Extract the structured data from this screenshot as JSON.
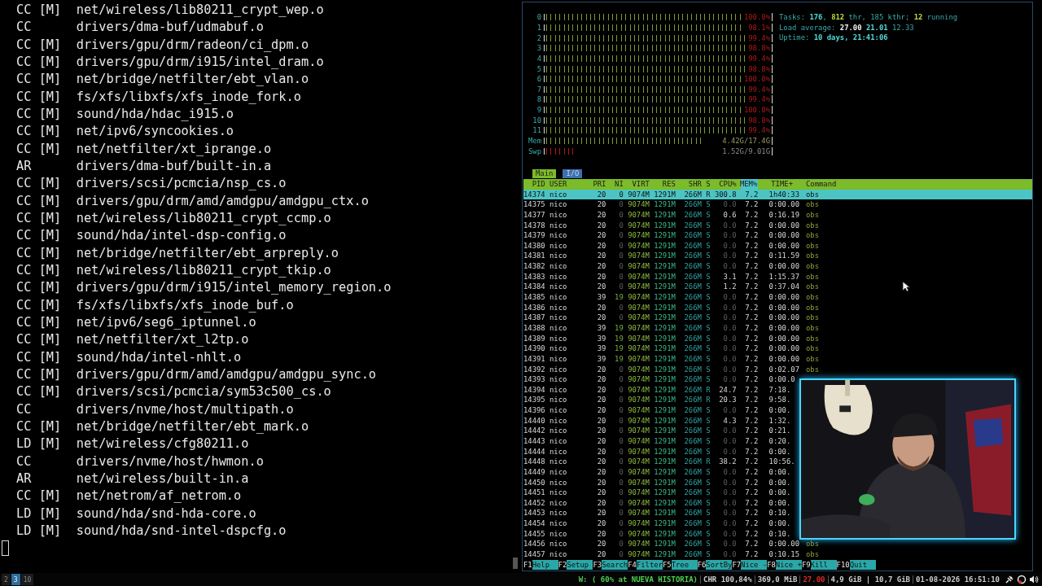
{
  "terminal": {
    "lines": [
      {
        "tag": "CC",
        "module": "[M]",
        "path": "net/wireless/lib80211_crypt_wep.o"
      },
      {
        "tag": "CC",
        "path": "drivers/dma-buf/udmabuf.o"
      },
      {
        "tag": "CC",
        "module": "[M]",
        "path": "drivers/gpu/drm/radeon/ci_dpm.o"
      },
      {
        "tag": "CC",
        "module": "[M]",
        "path": "drivers/gpu/drm/i915/intel_dram.o"
      },
      {
        "tag": "CC",
        "module": "[M]",
        "path": "net/bridge/netfilter/ebt_vlan.o"
      },
      {
        "tag": "CC",
        "module": "[M]",
        "path": "fs/xfs/libxfs/xfs_inode_fork.o"
      },
      {
        "tag": "CC",
        "module": "[M]",
        "path": "sound/hda/hdac_i915.o"
      },
      {
        "tag": "CC",
        "module": "[M]",
        "path": "net/ipv6/syncookies.o"
      },
      {
        "tag": "CC",
        "module": "[M]",
        "path": "net/netfilter/xt_iprange.o"
      },
      {
        "tag": "AR",
        "path": "drivers/dma-buf/built-in.a"
      },
      {
        "tag": "CC",
        "module": "[M]",
        "path": "drivers/scsi/pcmcia/nsp_cs.o"
      },
      {
        "tag": "CC",
        "module": "[M]",
        "path": "drivers/gpu/drm/amd/amdgpu/amdgpu_ctx.o"
      },
      {
        "tag": "CC",
        "module": "[M]",
        "path": "net/wireless/lib80211_crypt_ccmp.o"
      },
      {
        "tag": "CC",
        "module": "[M]",
        "path": "sound/hda/intel-dsp-config.o"
      },
      {
        "tag": "CC",
        "module": "[M]",
        "path": "net/bridge/netfilter/ebt_arpreply.o"
      },
      {
        "tag": "CC",
        "module": "[M]",
        "path": "net/wireless/lib80211_crypt_tkip.o"
      },
      {
        "tag": "CC",
        "module": "[M]",
        "path": "drivers/gpu/drm/i915/intel_memory_region.o"
      },
      {
        "tag": "CC",
        "module": "[M]",
        "path": "fs/xfs/libxfs/xfs_inode_buf.o"
      },
      {
        "tag": "CC",
        "module": "[M]",
        "path": "net/ipv6/seg6_iptunnel.o"
      },
      {
        "tag": "CC",
        "module": "[M]",
        "path": "net/netfilter/xt_l2tp.o"
      },
      {
        "tag": "CC",
        "module": "[M]",
        "path": "sound/hda/intel-nhlt.o"
      },
      {
        "tag": "CC",
        "module": "[M]",
        "path": "drivers/gpu/drm/amd/amdgpu/amdgpu_sync.o"
      },
      {
        "tag": "CC",
        "module": "[M]",
        "path": "drivers/scsi/pcmcia/sym53c500_cs.o"
      },
      {
        "tag": "CC",
        "path": "drivers/nvme/host/multipath.o"
      },
      {
        "tag": "CC",
        "module": "[M]",
        "path": "net/bridge/netfilter/ebt_mark.o"
      },
      {
        "tag": "LD",
        "module": "[M]",
        "path": "net/wireless/cfg80211.o"
      },
      {
        "tag": "CC",
        "path": "drivers/nvme/host/hwmon.o"
      },
      {
        "tag": "AR",
        "path": "net/wireless/built-in.a"
      },
      {
        "tag": "CC",
        "module": "[M]",
        "path": "net/netrom/af_netrom.o"
      },
      {
        "tag": "LD",
        "module": "[M]",
        "path": "sound/hda/snd-hda-core.o"
      },
      {
        "tag": "LD",
        "module": "[M]",
        "path": "sound/hda/snd-intel-dspcfg.o"
      }
    ]
  },
  "htop": {
    "meters": [
      {
        "label": "0",
        "kind": "cpu",
        "level": 1.0,
        "reading": "100.0%"
      },
      {
        "label": "1",
        "kind": "cpu",
        "level": 0.98,
        "reading": "98.1%"
      },
      {
        "label": "2",
        "kind": "cpu",
        "level": 0.99,
        "reading": "99.4%"
      },
      {
        "label": "3",
        "kind": "cpu",
        "level": 0.99,
        "reading": "98.8%"
      },
      {
        "label": "4",
        "kind": "cpu",
        "level": 0.99,
        "reading": "99.4%"
      },
      {
        "label": "5",
        "kind": "cpu",
        "level": 0.99,
        "reading": "98.8%"
      },
      {
        "label": "6",
        "kind": "cpu",
        "level": 1.0,
        "reading": "100.0%"
      },
      {
        "label": "7",
        "kind": "cpu",
        "level": 0.99,
        "reading": "99.4%"
      },
      {
        "label": "8",
        "kind": "cpu",
        "level": 0.99,
        "reading": "99.4%"
      },
      {
        "label": "9",
        "kind": "cpu",
        "level": 1.0,
        "reading": "100.0%"
      },
      {
        "label": "10",
        "kind": "cpu",
        "level": 0.99,
        "reading": "98.8%"
      },
      {
        "label": "11",
        "kind": "cpu",
        "level": 0.99,
        "reading": "99.4%"
      },
      {
        "label": "Mem",
        "kind": "mem",
        "level": 0.9,
        "reading": "4.42G/17.4G"
      },
      {
        "label": "Swp",
        "kind": "swap",
        "level": 0.17,
        "reading": "1.52G/9.01G"
      }
    ],
    "info": [
      {
        "parts": [
          {
            "text": "Tasks: ",
            "kind": "label"
          },
          {
            "text": "176",
            "kind": "value"
          },
          {
            "text": ", ",
            "kind": "label"
          },
          {
            "text": "812",
            "kind": "accent"
          },
          {
            "text": " thr, ",
            "kind": "label"
          },
          {
            "text": "185",
            "kind": "dim"
          },
          {
            "text": " kthr; ",
            "kind": "label"
          },
          {
            "text": "12",
            "kind": "accent"
          },
          {
            "text": " running",
            "kind": "label"
          }
        ]
      },
      {
        "parts": [
          {
            "text": "Load average: ",
            "kind": "label"
          },
          {
            "text": "27.00 ",
            "kind": "bright"
          },
          {
            "text": "21.01 ",
            "kind": "value"
          },
          {
            "text": "12.33",
            "kind": "plain"
          }
        ]
      },
      {
        "parts": [
          {
            "text": "Uptime: ",
            "kind": "label"
          },
          {
            "text": "10 days, 21:41:06",
            "kind": "value"
          }
        ]
      }
    ],
    "tabs": [
      {
        "label": "Main",
        "selected": true
      },
      {
        "label": "I/O",
        "selected": false
      }
    ],
    "columns": [
      {
        "label": "PID",
        "sorted": false
      },
      {
        "label": "USER",
        "sorted": false
      },
      {
        "label": "PRI",
        "sorted": false
      },
      {
        "label": "NI",
        "sorted": false
      },
      {
        "label": "VIRT",
        "sorted": false
      },
      {
        "label": "RES",
        "sorted": false
      },
      {
        "label": "SHR",
        "sorted": false
      },
      {
        "label": "S",
        "sorted": false
      },
      {
        "label": "CPU%",
        "sorted": false
      },
      {
        "label": "MEM%",
        "sorted": true
      },
      {
        "label": "TIME+",
        "sorted": false
      },
      {
        "label": "Command",
        "sorted": false
      }
    ],
    "rows": [
      {
        "pid": "14374",
        "user": "nico",
        "pri": "20",
        "ni": "0",
        "virt": "9074M",
        "res": "1291M",
        "shr": "266M",
        "state": "R",
        "cpu": "300.8",
        "mem": "7.2",
        "time": "1h40:33",
        "command": "obs",
        "selected": true
      },
      {
        "pid": "14375",
        "user": "nico",
        "pri": "20",
        "ni": "0",
        "virt": "9074M",
        "res": "1291M",
        "shr": "266M",
        "state": "S",
        "cpu": "0.0",
        "mem": "7.2",
        "time": "0:00.00",
        "command": "obs",
        "selected": false
      },
      {
        "pid": "14377",
        "user": "nico",
        "pri": "20",
        "ni": "0",
        "virt": "9074M",
        "res": "1291M",
        "shr": "266M",
        "state": "S",
        "cpu": "0.6",
        "mem": "7.2",
        "time": "0:16.19",
        "command": "obs",
        "selected": false
      },
      {
        "pid": "14378",
        "user": "nico",
        "pri": "20",
        "ni": "0",
        "virt": "9074M",
        "res": "1291M",
        "shr": "266M",
        "state": "S",
        "cpu": "0.0",
        "mem": "7.2",
        "time": "0:00.00",
        "command": "obs",
        "selected": false
      },
      {
        "pid": "14379",
        "user": "nico",
        "pri": "20",
        "ni": "0",
        "virt": "9074M",
        "res": "1291M",
        "shr": "266M",
        "state": "S",
        "cpu": "0.0",
        "mem": "7.2",
        "time": "0:00.00",
        "command": "obs",
        "selected": false
      },
      {
        "pid": "14380",
        "user": "nico",
        "pri": "20",
        "ni": "0",
        "virt": "9074M",
        "res": "1291M",
        "shr": "266M",
        "state": "S",
        "cpu": "0.0",
        "mem": "7.2",
        "time": "0:00.00",
        "command": "obs",
        "selected": false
      },
      {
        "pid": "14381",
        "user": "nico",
        "pri": "20",
        "ni": "0",
        "virt": "9074M",
        "res": "1291M",
        "shr": "266M",
        "state": "S",
        "cpu": "0.0",
        "mem": "7.2",
        "time": "0:11.59",
        "command": "obs",
        "selected": false
      },
      {
        "pid": "14382",
        "user": "nico",
        "pri": "20",
        "ni": "0",
        "virt": "9074M",
        "res": "1291M",
        "shr": "266M",
        "state": "S",
        "cpu": "0.0",
        "mem": "7.2",
        "time": "0:00.00",
        "command": "obs",
        "selected": false
      },
      {
        "pid": "14383",
        "user": "nico",
        "pri": "20",
        "ni": "0",
        "virt": "9074M",
        "res": "1291M",
        "shr": "266M",
        "state": "S",
        "cpu": "3.1",
        "mem": "7.2",
        "time": "1:15.37",
        "command": "obs",
        "selected": false
      },
      {
        "pid": "14384",
        "user": "nico",
        "pri": "20",
        "ni": "0",
        "virt": "9074M",
        "res": "1291M",
        "shr": "266M",
        "state": "S",
        "cpu": "1.2",
        "mem": "7.2",
        "time": "0:37.04",
        "command": "obs",
        "selected": false
      },
      {
        "pid": "14385",
        "user": "nico",
        "pri": "39",
        "ni": "19",
        "virt": "9074M",
        "res": "1291M",
        "shr": "266M",
        "state": "S",
        "cpu": "0.0",
        "mem": "7.2",
        "time": "0:00.00",
        "command": "obs",
        "selected": false
      },
      {
        "pid": "14386",
        "user": "nico",
        "pri": "20",
        "ni": "0",
        "virt": "9074M",
        "res": "1291M",
        "shr": "266M",
        "state": "S",
        "cpu": "0.0",
        "mem": "7.2",
        "time": "0:00.00",
        "command": "obs",
        "selected": false
      },
      {
        "pid": "14387",
        "user": "nico",
        "pri": "20",
        "ni": "0",
        "virt": "9074M",
        "res": "1291M",
        "shr": "266M",
        "state": "S",
        "cpu": "0.0",
        "mem": "7.2",
        "time": "0:00.00",
        "command": "obs",
        "selected": false
      },
      {
        "pid": "14388",
        "user": "nico",
        "pri": "39",
        "ni": "19",
        "virt": "9074M",
        "res": "1291M",
        "shr": "266M",
        "state": "S",
        "cpu": "0.0",
        "mem": "7.2",
        "time": "0:00.00",
        "command": "obs",
        "selected": false
      },
      {
        "pid": "14389",
        "user": "nico",
        "pri": "39",
        "ni": "19",
        "virt": "9074M",
        "res": "1291M",
        "shr": "266M",
        "state": "S",
        "cpu": "0.0",
        "mem": "7.2",
        "time": "0:00.00",
        "command": "obs",
        "selected": false
      },
      {
        "pid": "14390",
        "user": "nico",
        "pri": "39",
        "ni": "19",
        "virt": "9074M",
        "res": "1291M",
        "shr": "266M",
        "state": "S",
        "cpu": "0.0",
        "mem": "7.2",
        "time": "0:00.00",
        "command": "obs",
        "selected": false
      },
      {
        "pid": "14391",
        "user": "nico",
        "pri": "39",
        "ni": "19",
        "virt": "9074M",
        "res": "1291M",
        "shr": "266M",
        "state": "S",
        "cpu": "0.0",
        "mem": "7.2",
        "time": "0:00.00",
        "command": "obs",
        "selected": false
      },
      {
        "pid": "14392",
        "user": "nico",
        "pri": "20",
        "ni": "0",
        "virt": "9074M",
        "res": "1291M",
        "shr": "266M",
        "state": "S",
        "cpu": "0.0",
        "mem": "7.2",
        "time": "0:02.07",
        "command": "obs",
        "selected": false
      },
      {
        "pid": "14393",
        "user": "nico",
        "pri": "20",
        "ni": "0",
        "virt": "9074M",
        "res": "1291M",
        "shr": "266M",
        "state": "S",
        "cpu": "0.0",
        "mem": "7.2",
        "time": "0:00.0",
        "selected": false
      },
      {
        "pid": "14394",
        "user": "nico",
        "pri": "20",
        "ni": "0",
        "virt": "9074M",
        "res": "1291M",
        "shr": "266M",
        "state": "R",
        "cpu": "24.7",
        "mem": "7.2",
        "time": "7:18.",
        "selected": false
      },
      {
        "pid": "14395",
        "user": "nico",
        "pri": "20",
        "ni": "0",
        "virt": "9074M",
        "res": "1291M",
        "shr": "266M",
        "state": "R",
        "cpu": "20.3",
        "mem": "7.2",
        "time": "9:58.",
        "selected": false
      },
      {
        "pid": "14396",
        "user": "nico",
        "pri": "20",
        "ni": "0",
        "virt": "9074M",
        "res": "1291M",
        "shr": "266M",
        "state": "S",
        "cpu": "0.0",
        "mem": "7.2",
        "time": "0:00.",
        "selected": false
      },
      {
        "pid": "14440",
        "user": "nico",
        "pri": "20",
        "ni": "0",
        "virt": "9074M",
        "res": "1291M",
        "shr": "266M",
        "state": "S",
        "cpu": "4.3",
        "mem": "7.2",
        "time": "1:32.",
        "selected": false
      },
      {
        "pid": "14442",
        "user": "nico",
        "pri": "20",
        "ni": "0",
        "virt": "9074M",
        "res": "1291M",
        "shr": "266M",
        "state": "S",
        "cpu": "0.0",
        "mem": "7.2",
        "time": "0:21.",
        "selected": false
      },
      {
        "pid": "14443",
        "user": "nico",
        "pri": "20",
        "ni": "0",
        "virt": "9074M",
        "res": "1291M",
        "shr": "266M",
        "state": "S",
        "cpu": "0.0",
        "mem": "7.2",
        "time": "0:20.",
        "selected": false
      },
      {
        "pid": "14444",
        "user": "nico",
        "pri": "20",
        "ni": "0",
        "virt": "9074M",
        "res": "1291M",
        "shr": "266M",
        "state": "S",
        "cpu": "0.0",
        "mem": "7.2",
        "time": "0:00.",
        "selected": false
      },
      {
        "pid": "14448",
        "user": "nico",
        "pri": "20",
        "ni": "0",
        "virt": "9074M",
        "res": "1291M",
        "shr": "266M",
        "state": "R",
        "cpu": "38.2",
        "mem": "7.2",
        "time": "10:56.",
        "selected": false
      },
      {
        "pid": "14449",
        "user": "nico",
        "pri": "20",
        "ni": "0",
        "virt": "9074M",
        "res": "1291M",
        "shr": "266M",
        "state": "S",
        "cpu": "0.0",
        "mem": "7.2",
        "time": "0:00.",
        "selected": false
      },
      {
        "pid": "14450",
        "user": "nico",
        "pri": "20",
        "ni": "0",
        "virt": "9074M",
        "res": "1291M",
        "shr": "266M",
        "state": "S",
        "cpu": "0.0",
        "mem": "7.2",
        "time": "0:00.",
        "selected": false
      },
      {
        "pid": "14451",
        "user": "nico",
        "pri": "20",
        "ni": "0",
        "virt": "9074M",
        "res": "1291M",
        "shr": "266M",
        "state": "S",
        "cpu": "0.0",
        "mem": "7.2",
        "time": "0:00.",
        "selected": false
      },
      {
        "pid": "14452",
        "user": "nico",
        "pri": "20",
        "ni": "0",
        "virt": "9074M",
        "res": "1291M",
        "shr": "266M",
        "state": "S",
        "cpu": "0.0",
        "mem": "7.2",
        "time": "0:00.",
        "selected": false
      },
      {
        "pid": "14453",
        "user": "nico",
        "pri": "20",
        "ni": "0",
        "virt": "9074M",
        "res": "1291M",
        "shr": "266M",
        "state": "S",
        "cpu": "0.0",
        "mem": "7.2",
        "time": "0:10.",
        "selected": false
      },
      {
        "pid": "14454",
        "user": "nico",
        "pri": "20",
        "ni": "0",
        "virt": "9074M",
        "res": "1291M",
        "shr": "266M",
        "state": "S",
        "cpu": "0.0",
        "mem": "7.2",
        "time": "0:00.",
        "selected": false
      },
      {
        "pid": "14455",
        "user": "nico",
        "pri": "20",
        "ni": "0",
        "virt": "9074M",
        "res": "1291M",
        "shr": "266M",
        "state": "S",
        "cpu": "0.0",
        "mem": "7.2",
        "time": "0:10.",
        "selected": false
      },
      {
        "pid": "14456",
        "user": "nico",
        "pri": "20",
        "ni": "0",
        "virt": "9074M",
        "res": "1291M",
        "shr": "266M",
        "state": "S",
        "cpu": "0.0",
        "mem": "7.2",
        "time": "0:00.00",
        "command": "obs",
        "selected": false
      },
      {
        "pid": "14457",
        "user": "nico",
        "pri": "20",
        "ni": "0",
        "virt": "9074M",
        "res": "1291M",
        "shr": "266M",
        "state": "S",
        "cpu": "0.0",
        "mem": "7.2",
        "time": "0:10.15",
        "command": "obs",
        "selected": false
      }
    ],
    "function_keys": [
      {
        "key": "F1",
        "label": "Help"
      },
      {
        "key": "F2",
        "label": "Setup"
      },
      {
        "key": "F3",
        "label": "Search"
      },
      {
        "key": "F4",
        "label": "Filter"
      },
      {
        "key": "F5",
        "label": "Tree"
      },
      {
        "key": "F6",
        "label": "SortBy"
      },
      {
        "key": "F7",
        "label": "Nice -"
      },
      {
        "key": "F8",
        "label": "Nice +"
      },
      {
        "key": "F9",
        "label": "Kill"
      },
      {
        "key": "F10",
        "label": "Quit"
      }
    ]
  },
  "status_bar": {
    "workspaces": [
      {
        "label": "2",
        "selected": false
      },
      {
        "label": "3",
        "selected": true
      },
      {
        "label": "10",
        "selected": false
      }
    ],
    "items": [
      {
        "text": "W: ( 60% at NUEVA HISTORIA)",
        "color": "#4fd14f"
      },
      {
        "text": "CHR 100,84%",
        "color": "#cfcfcf"
      },
      {
        "text": "369,0 MiB",
        "color": "#cfcfcf"
      },
      {
        "text": "27.00",
        "color": "#e02828"
      },
      {
        "text": "4,9 GiB | 10,7 GiB",
        "color": "#cfcfcf"
      },
      {
        "text": "01-08-2026 16:51:10",
        "color": "#cfcfcf"
      }
    ]
  }
}
